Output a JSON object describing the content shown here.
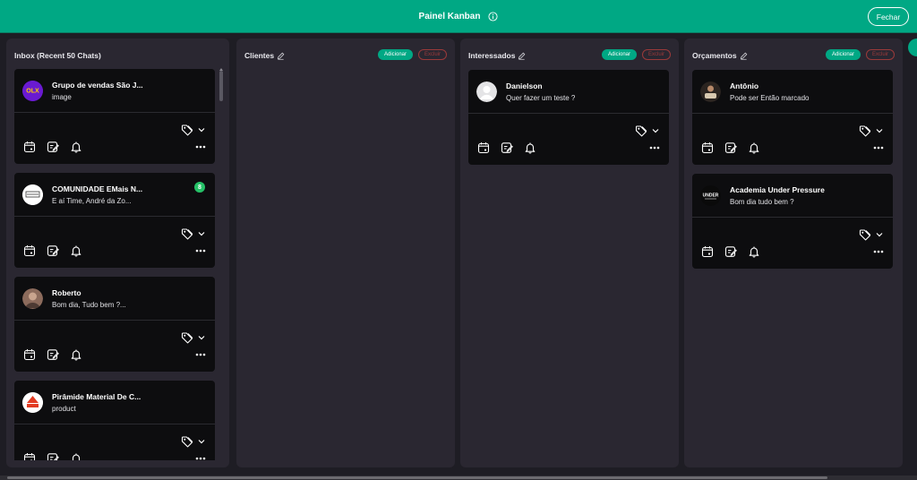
{
  "header": {
    "title": "Painel Kanban",
    "close_label": "Fechar"
  },
  "columns": {
    "inbox": {
      "title": "Inbox (Recent 50 Chats)",
      "cards": [
        {
          "name": "Grupo de vendas São J...",
          "message": "image"
        },
        {
          "name": "COMUNIDADE EMais N...",
          "message": "E aí Time, André da Zo...",
          "badge": "8"
        },
        {
          "name": "Roberto",
          "message": "Bom dia, Tudo bem ?..."
        },
        {
          "name": "Pirâmide Material De C...",
          "message": "product"
        }
      ]
    },
    "clientes": {
      "title": "Clientes",
      "add_label": "Adicionar",
      "delete_label": "Excluir",
      "cards": []
    },
    "interessados": {
      "title": "Interessados",
      "add_label": "Adicionar",
      "delete_label": "Excluir",
      "cards": [
        {
          "name": "Danielson",
          "message": "Quer fazer um teste ?"
        }
      ]
    },
    "orcamentos": {
      "title": "Orçamentos",
      "add_label": "Adicionar",
      "delete_label": "Excluir",
      "cards": [
        {
          "name": "Antônio",
          "message": "Pode ser Então marcado"
        },
        {
          "name": "Academia Under Pressure",
          "message": "Bom dia tudo bem ?"
        }
      ]
    }
  },
  "avatars": {
    "grupo_logo": "OLX",
    "under_logo": "UNDER"
  },
  "colors": {
    "accent": "#00a884",
    "board_bg": "#1e1d24",
    "column_bg": "#2a2731",
    "card_bg": "#0d0d0f",
    "delete_red": "#9b3a3a",
    "badge_green": "#25c167"
  }
}
